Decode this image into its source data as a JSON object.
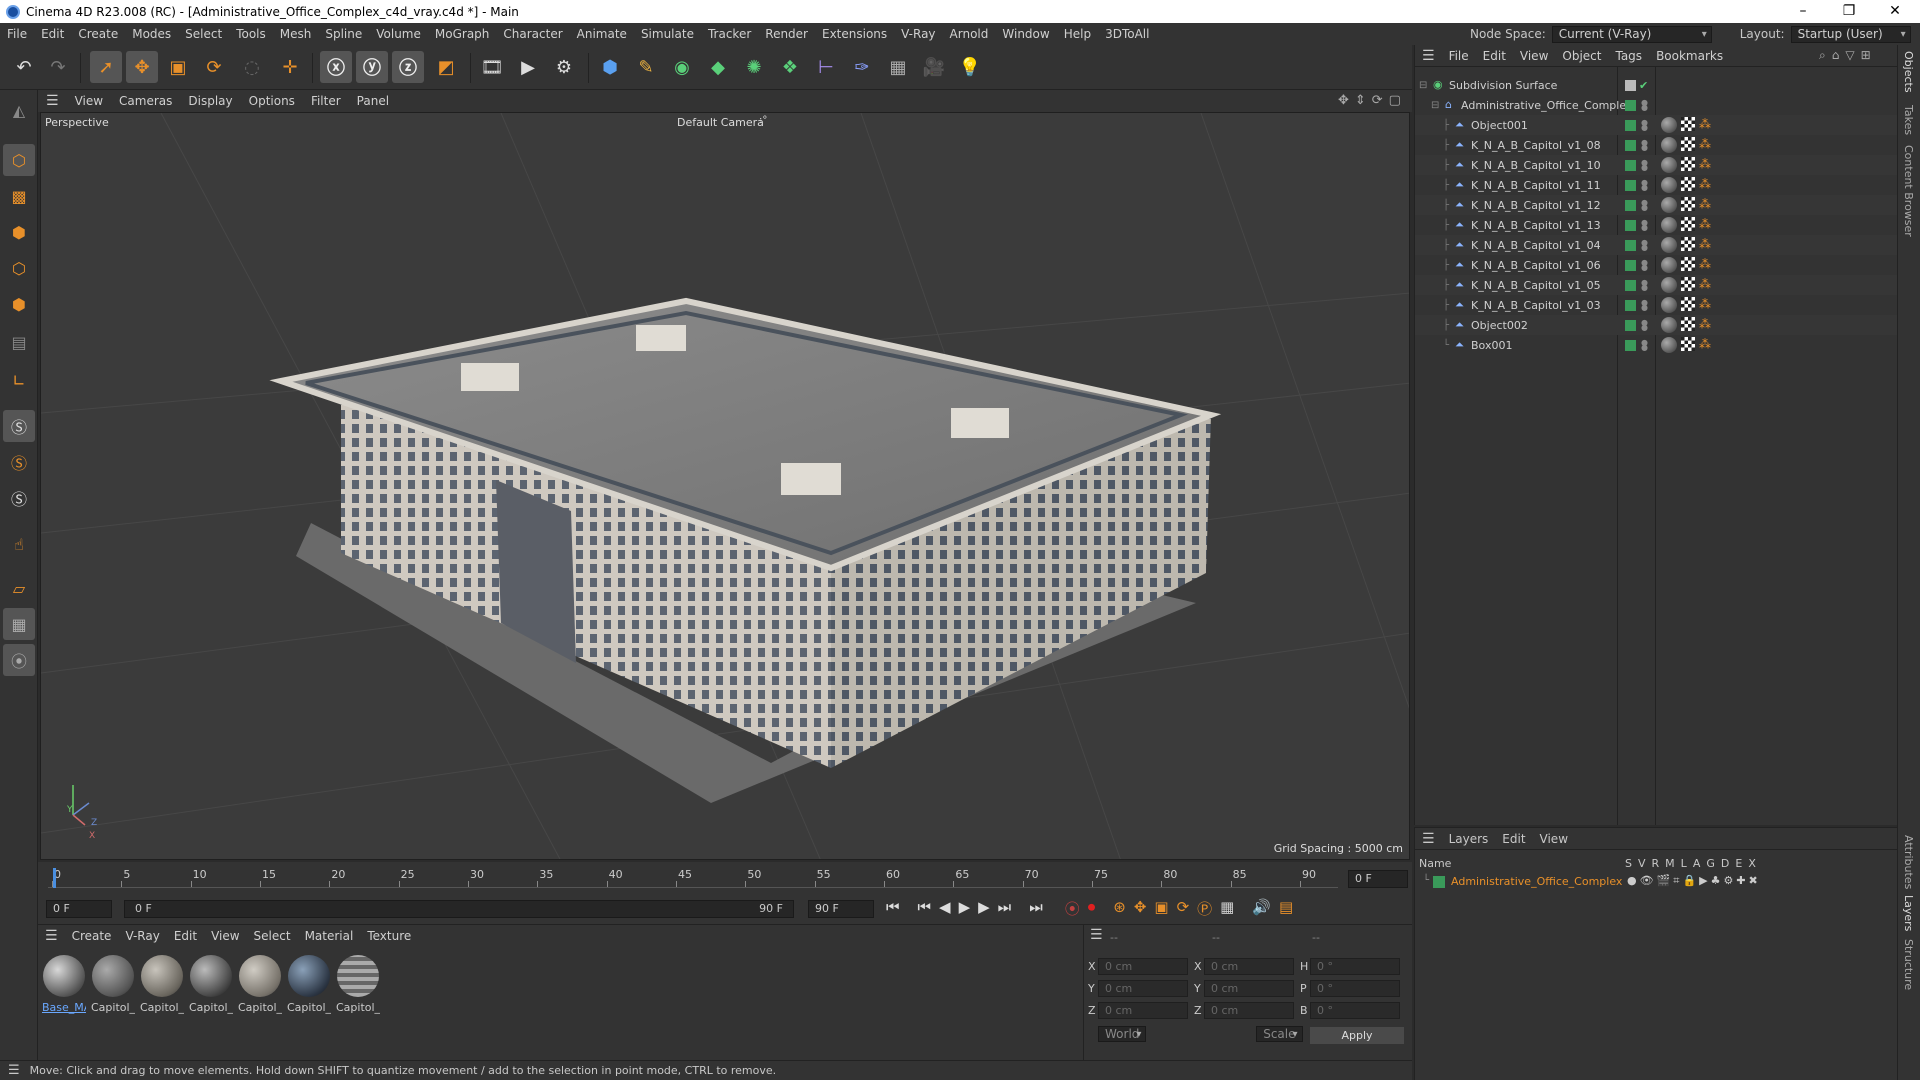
{
  "window": {
    "title": "Cinema 4D R23.008 (RC) - [Administrative_Office_Complex_c4d_vray.c4d *] - Main",
    "minimize": "–",
    "maximize": "❐",
    "close": "✕"
  },
  "menubar": {
    "items": [
      "File",
      "Edit",
      "Create",
      "Modes",
      "Select",
      "Tools",
      "Mesh",
      "Spline",
      "Volume",
      "MoGraph",
      "Character",
      "Animate",
      "Simulate",
      "Tracker",
      "Render",
      "Extensions",
      "V-Ray",
      "Arnold",
      "Window",
      "Help",
      "3DToAll"
    ],
    "node_space_label": "Node Space:",
    "node_space_value": "Current (V-Ray)",
    "layout_label": "Layout:",
    "layout_value": "Startup (User)"
  },
  "viewport": {
    "menu": [
      "View",
      "Cameras",
      "Display",
      "Options",
      "Filter",
      "Panel"
    ],
    "name": "Perspective",
    "camera": "Default Camera",
    "camera_suffix": ":°",
    "grid_spacing": "Grid Spacing : 5000 cm",
    "axis_y": "Y",
    "axis_z": "Z",
    "axis_x": "X"
  },
  "timeline": {
    "ticks": [
      "0",
      "5",
      "10",
      "15",
      "20",
      "25",
      "30",
      "35",
      "40",
      "45",
      "50",
      "55",
      "60",
      "65",
      "70",
      "75",
      "80",
      "85",
      "90"
    ],
    "end_frame_field": "0 F",
    "current_frame": "0 F",
    "range_start": "0 F",
    "range_end": "90 F",
    "max_frame": "90 F"
  },
  "materials": {
    "menu": [
      "Create",
      "V-Ray",
      "Edit",
      "View",
      "Select",
      "Material",
      "Texture"
    ],
    "items": [
      {
        "label": "Base_MA"
      },
      {
        "label": "Capitol_"
      },
      {
        "label": "Capitol_"
      },
      {
        "label": "Capitol_"
      },
      {
        "label": "Capitol_"
      },
      {
        "label": "Capitol_"
      },
      {
        "label": "Capitol_"
      }
    ]
  },
  "coordinates": {
    "col_headers": [
      "--",
      "--",
      "--"
    ],
    "rows": [
      {
        "a": "X",
        "av": "0 cm",
        "b": "X",
        "bv": "0 cm",
        "c": "H",
        "cv": "0 °"
      },
      {
        "a": "Y",
        "av": "0 cm",
        "b": "Y",
        "bv": "0 cm",
        "c": "P",
        "cv": "0 °"
      },
      {
        "a": "Z",
        "av": "0 cm",
        "b": "Z",
        "bv": "0 cm",
        "c": "B",
        "cv": "0 °"
      }
    ],
    "space": "World",
    "mode": "Scale",
    "apply": "Apply"
  },
  "status": {
    "text": "Move: Click and drag to move elements. Hold down SHIFT to quantize movement / add to the selection in point mode, CTRL to remove."
  },
  "object_manager": {
    "menu": [
      "File",
      "Edit",
      "View",
      "Object",
      "Tags",
      "Bookmarks"
    ],
    "root": "Subdivision Surface",
    "group": "Administrative_Office_Complex",
    "objects": [
      "Object001",
      "K_N_A_B_Capitol_v1_08",
      "K_N_A_B_Capitol_v1_10",
      "K_N_A_B_Capitol_v1_11",
      "K_N_A_B_Capitol_v1_12",
      "K_N_A_B_Capitol_v1_13",
      "K_N_A_B_Capitol_v1_04",
      "K_N_A_B_Capitol_v1_06",
      "K_N_A_B_Capitol_v1_05",
      "K_N_A_B_Capitol_v1_03",
      "Object002",
      "Box001"
    ]
  },
  "layer_manager": {
    "menu": [
      "Layers",
      "Edit",
      "View"
    ],
    "name_col": "Name",
    "flags": [
      "S",
      "V",
      "R",
      "M",
      "L",
      "A",
      "G",
      "D",
      "E",
      "X"
    ],
    "layer": "Administrative_Office_Complex"
  },
  "right_tabs": [
    "Objects",
    "Takes",
    "Content Browser",
    "Attributes",
    "Layers",
    "Structure"
  ],
  "colors": {
    "layer_name": "#e8902a",
    "accent_blue": "#4a8fe0",
    "record": "#d02020"
  }
}
